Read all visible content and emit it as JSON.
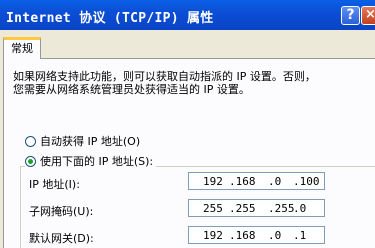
{
  "window": {
    "title": "Internet 协议 (TCP/IP) 属性",
    "help_label": "?",
    "close_label": "×"
  },
  "tabs": [
    {
      "label": "常规"
    }
  ],
  "general": {
    "description_line1": "如果网络支持此功能，则可以获取自动指派的 IP 设置。否则，",
    "description_line2": "您需要从网络系统管理员处获得适当的 IP 设置。",
    "auto_ip_option": "自动获得 IP 地址(O)",
    "manual_ip_option": "使用下面的 IP 地址(S):",
    "ip_label": "IP 地址(I):",
    "ip_parts": [
      "192",
      ".168",
      ".0",
      ".100"
    ],
    "subnet_label": "子网掩码(U):",
    "subnet_parts": [
      "255",
      ".255",
      ".255",
      ".0"
    ],
    "gateway_label": "默认网关(D):",
    "gateway_parts": [
      "192",
      ".168",
      ".0",
      ".1"
    ]
  },
  "colors": {
    "titlebar": "#0b4fd6",
    "dialog_face": "#ece9d8",
    "tab_highlight": "#ffc83c",
    "radio_dot": "#21a121"
  }
}
